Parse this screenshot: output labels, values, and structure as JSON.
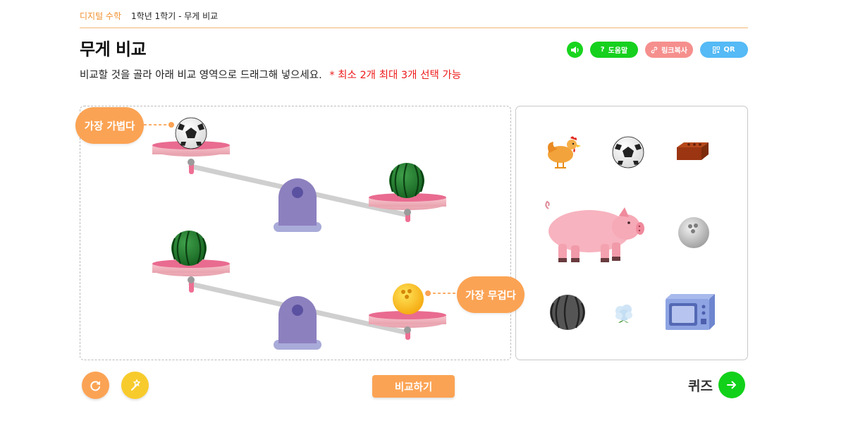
{
  "breadcrumb": {
    "subject": "디지털 수학",
    "path": "1학년 1학기 - 무게 비교"
  },
  "page": {
    "title": "무게 비교",
    "instruction": "비교할 것을 골라 아래 비교 영역으로 드래그해 넣으세요.",
    "note": "* 최소 2개 최대 3개 선택 가능"
  },
  "toolbar": {
    "sound_icon": "speaker-icon",
    "help_label": "도움말",
    "link_label": "링크복사",
    "qr_label": "QR"
  },
  "stage": {
    "lightest_label": "가장 가볍다",
    "heaviest_label": "가장 무겁다",
    "top_scale": {
      "left_item": "soccer-ball",
      "right_item": "watermelon",
      "heavier_side": "right"
    },
    "bottom_scale": {
      "left_item": "watermelon",
      "right_item": "bowling-ball-yellow",
      "heavier_side": "right"
    }
  },
  "tray_items": [
    "chicken",
    "soccer-ball",
    "brick",
    "pig",
    "bowling-ball",
    "watermelon",
    "cotton",
    "microwave"
  ],
  "footer": {
    "reset_icon": "reset-icon",
    "magic_icon": "magic-wand-icon",
    "compare_label": "비교하기",
    "quiz_label": "퀴즈"
  },
  "colors": {
    "accent_orange": "#fba354",
    "green": "#16d01e",
    "pink_button": "#f58f8d",
    "blue_button": "#55baf5",
    "note_red": "#ee1c1c",
    "scale_purple": "#8d80bf"
  }
}
